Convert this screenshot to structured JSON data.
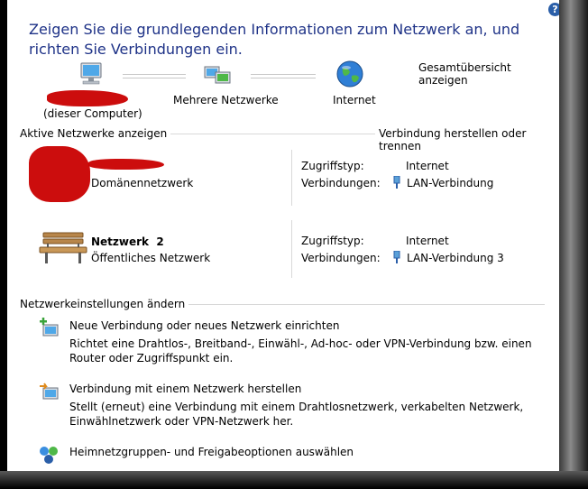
{
  "title": "Zeigen Sie die grundlegenden Informationen zum Netzwerk an, und richten Sie Verbindungen ein.",
  "help_icon": "?",
  "map": {
    "overview_link": "Gesamtübersicht anzeigen",
    "computer_label": "(dieser Computer)",
    "networks_label": "Mehrere Netzwerke",
    "internet_label": "Internet"
  },
  "active": {
    "header": "Aktive Netzwerke anzeigen",
    "connect_link": "Verbindung herstellen oder trennen",
    "networks": [
      {
        "name": "",
        "type": "Domänennetzwerk",
        "access_label": "Zugriffstyp:",
        "access_value": "Internet",
        "conn_label": "Verbindungen:",
        "conn_value": "LAN-Verbindung"
      },
      {
        "name": "Netzwerk  2",
        "type": "Öffentliches Netzwerk",
        "access_label": "Zugriffstyp:",
        "access_value": "Internet",
        "conn_label": "Verbindungen:",
        "conn_value": "LAN-Verbindung 3"
      }
    ]
  },
  "settings": {
    "header": "Netzwerkeinstellungen ändern",
    "items": [
      {
        "title": "Neue Verbindung oder neues Netzwerk einrichten",
        "desc": "Richtet eine Drahtlos-, Breitband-, Einwähl-, Ad-hoc- oder VPN-Verbindung bzw. einen Router oder Zugriffspunkt ein."
      },
      {
        "title": "Verbindung mit einem Netzwerk herstellen",
        "desc": "Stellt (erneut) eine Verbindung mit einem Drahtlosnetzwerk, verkabelten Netzwerk, Einwählnetzwerk oder VPN-Netzwerk her."
      },
      {
        "title": "Heimnetzgruppen- und Freigabeoptionen auswählen",
        "desc": ""
      }
    ]
  },
  "colors": {
    "link": "#0a59b8",
    "title": "#1e3287",
    "redaction": "#c90000"
  }
}
